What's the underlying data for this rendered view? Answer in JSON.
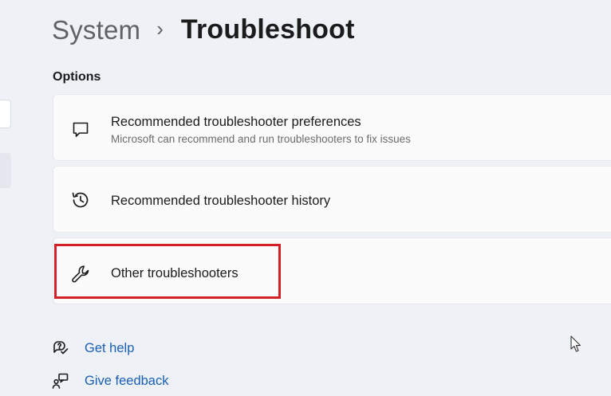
{
  "breadcrumb": {
    "parent": "System",
    "separator": "›",
    "current": "Troubleshoot"
  },
  "options_section": {
    "title": "Options"
  },
  "cards": [
    {
      "icon": "chat-bubble-icon",
      "title": "Recommended troubleshooter preferences",
      "description": "Microsoft can recommend and run troubleshooters to fix issues"
    },
    {
      "icon": "history-icon",
      "title": "Recommended troubleshooter history"
    },
    {
      "icon": "wrench-icon",
      "title": "Other troubleshooters"
    }
  ],
  "footer_links": [
    {
      "icon": "help-icon",
      "label": "Get help"
    },
    {
      "icon": "feedback-icon",
      "label": "Give feedback"
    }
  ],
  "colors": {
    "background": "#eef1f6",
    "card": "#fbfbfc",
    "link": "#1a5fb4",
    "highlight": "#d42027"
  }
}
